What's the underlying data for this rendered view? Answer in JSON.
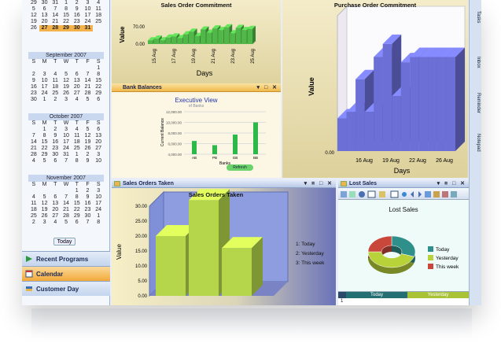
{
  "calendars": [
    {
      "title": "",
      "rows": [
        [
          "29",
          "30",
          "31",
          "1",
          "2",
          "3",
          "4"
        ],
        [
          "5",
          "6",
          "7",
          "8",
          "9",
          "10",
          "11"
        ],
        [
          "12",
          "13",
          "14",
          "15",
          "16",
          "17",
          "18"
        ],
        [
          "19",
          "20",
          "21",
          "22",
          "23",
          "24",
          "25"
        ],
        [
          "26",
          "27",
          "28",
          "29",
          "30",
          "31",
          ""
        ]
      ],
      "highlight_row": 4
    },
    {
      "title": "September 2007",
      "rows": [
        [
          "",
          "",
          "",
          "",
          "",
          "",
          "1"
        ],
        [
          "2",
          "3",
          "4",
          "5",
          "6",
          "7",
          "8"
        ],
        [
          "9",
          "10",
          "11",
          "12",
          "13",
          "14",
          "15"
        ],
        [
          "16",
          "17",
          "18",
          "19",
          "20",
          "21",
          "22"
        ],
        [
          "23",
          "24",
          "25",
          "26",
          "27",
          "28",
          "29"
        ],
        [
          "30",
          "1",
          "2",
          "3",
          "4",
          "5",
          "6"
        ]
      ]
    },
    {
      "title": "October 2007",
      "rows": [
        [
          "",
          "1",
          "2",
          "3",
          "4",
          "5",
          "6"
        ],
        [
          "7",
          "8",
          "9",
          "10",
          "11",
          "12",
          "13"
        ],
        [
          "14",
          "15",
          "16",
          "17",
          "18",
          "19",
          "20"
        ],
        [
          "21",
          "22",
          "23",
          "24",
          "25",
          "26",
          "27"
        ],
        [
          "28",
          "29",
          "30",
          "31",
          "1",
          "2",
          "3"
        ],
        [
          "4",
          "5",
          "6",
          "7",
          "8",
          "9",
          "10"
        ]
      ]
    },
    {
      "title": "November 2007",
      "rows": [
        [
          "",
          "",
          "",
          "",
          "1",
          "2",
          "3"
        ],
        [
          "4",
          "5",
          "6",
          "7",
          "8",
          "9",
          "10"
        ],
        [
          "11",
          "12",
          "13",
          "14",
          "15",
          "16",
          "17"
        ],
        [
          "18",
          "19",
          "20",
          "21",
          "22",
          "23",
          "24"
        ],
        [
          "25",
          "26",
          "27",
          "28",
          "29",
          "30",
          "1"
        ],
        [
          "2",
          "3",
          "4",
          "5",
          "6",
          "7",
          "8"
        ]
      ]
    }
  ],
  "dow": [
    "S",
    "M",
    "T",
    "W",
    "T",
    "F",
    "S"
  ],
  "today_label": "Today",
  "nav": {
    "recent": "Recent Programs",
    "calendar": "Calendar",
    "customer": "Customer Day"
  },
  "dock_tabs": [
    "Tasks",
    "Inbox",
    "Reminder",
    "Notepad"
  ],
  "panels": {
    "sales_commit": {
      "title": "Sales Order Commitment",
      "ylabel": "Value",
      "xlabel": "Days"
    },
    "purchase_commit": {
      "title": "Purchase Order Commitment",
      "ylabel": "Value",
      "xlabel": "Days"
    },
    "bank": {
      "bar": "Bank Balances",
      "title": "Executive View",
      "subtitle": "of Banks",
      "ylabel": "Current Balance",
      "xlabel": "Banks",
      "button": "Refresh"
    },
    "sales_taken": {
      "bar": "Sales Orders Taken",
      "title": "Sales Orders Taken",
      "ylabel": "Value"
    },
    "lost": {
      "bar": "Lost Sales",
      "title": "Lost Sales",
      "table_head": [
        "Today",
        "Yesterday"
      ],
      "table_row": "1"
    }
  },
  "chart_data": [
    {
      "type": "bar",
      "title": "Sales Order Commitment",
      "xlabel": "Days",
      "ylabel": "Value",
      "ytick_labels": [
        "70.00",
        "0.00"
      ],
      "xtick_labels": [
        "15 Aug",
        "17 Aug",
        "19 Aug",
        "21 Aug",
        "23 Aug",
        "25 Aug"
      ],
      "values": [
        14,
        20,
        14,
        24,
        28,
        22,
        36,
        46,
        30,
        54,
        42,
        58,
        52,
        62,
        40,
        60,
        52,
        56
      ],
      "ylim": [
        0,
        70
      ]
    },
    {
      "type": "bar",
      "title": "Purchase Order Commitment",
      "xlabel": "Days",
      "ylabel": "Value",
      "ytick_labels": [
        "0.00"
      ],
      "xtick_labels": [
        "16 Aug",
        "19 Aug",
        "22 Aug",
        "26 Aug"
      ],
      "values": [
        0.25,
        0.3,
        0.55,
        0.3,
        0.72,
        0.82,
        0.42,
        0.68,
        0.72,
        0.72,
        0.72,
        0.72,
        0.72
      ],
      "ylim": [
        0,
        1
      ]
    },
    {
      "type": "bar",
      "title": "Executive View",
      "subtitle": "of Banks",
      "xlabel": "Banks",
      "ylabel": "Current Balance",
      "categories": [
        "AB",
        "PB",
        "GB",
        "BB"
      ],
      "ytick_labels": [
        "12,000.00",
        "10,000.00",
        "8,000.00",
        "6,000.00",
        "4,000.00"
      ],
      "values": [
        6500,
        5700,
        7700,
        10000
      ],
      "ylim": [
        4000,
        12000
      ]
    },
    {
      "type": "bar",
      "title": "Sales Orders Taken",
      "ylabel": "Value",
      "ytick_labels": [
        "30.00",
        "25.00",
        "20.00",
        "15.00",
        "10.00",
        "5.00",
        "0.00"
      ],
      "legend": [
        "1: Today",
        "2: Yesterday",
        "3: This week"
      ],
      "values": [
        20,
        32,
        16
      ],
      "ylim": [
        0,
        30
      ]
    },
    {
      "type": "pie",
      "title": "Lost Sales",
      "legend": [
        "Today",
        "Yesterday",
        "This week"
      ],
      "values": [
        30,
        45,
        25
      ],
      "colors": [
        "#2f8f8a",
        "#b8d23a",
        "#c9473a"
      ]
    }
  ]
}
